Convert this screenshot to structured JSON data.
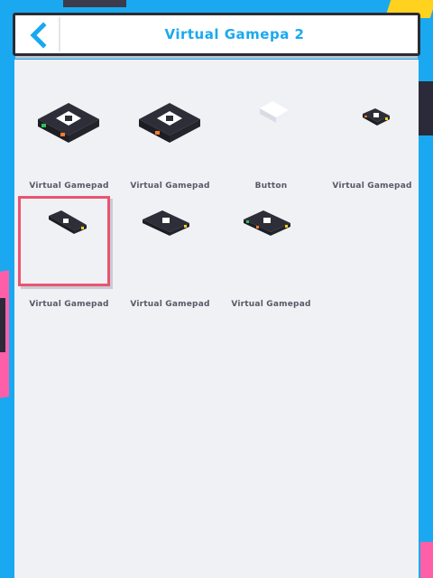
{
  "header": {
    "title": "Virtual Gamepa 2",
    "back_icon": "chevron-left-icon"
  },
  "colors": {
    "background": "#1aa9f0",
    "title": "#1aa9f0",
    "selection": "#ea5470",
    "panel": "#f0f1f5"
  },
  "items": [
    {
      "label": "Virtual Gamepad",
      "icon": "gamepad-block-icon"
    },
    {
      "label": "Virtual Gamepad",
      "icon": "gamepad-block-icon"
    },
    {
      "label": "Button",
      "icon": "button-icon"
    },
    {
      "label": "Virtual Gamepad",
      "icon": "gamepad-small-icon"
    },
    {
      "label": "Virtual Gamepad",
      "icon": "gamepad-small-icon",
      "selected": true
    },
    {
      "label": "Virtual Gamepad",
      "icon": "gamepad-small-icon"
    },
    {
      "label": "Virtual Gamepad",
      "icon": "gamepad-small-icon"
    }
  ]
}
